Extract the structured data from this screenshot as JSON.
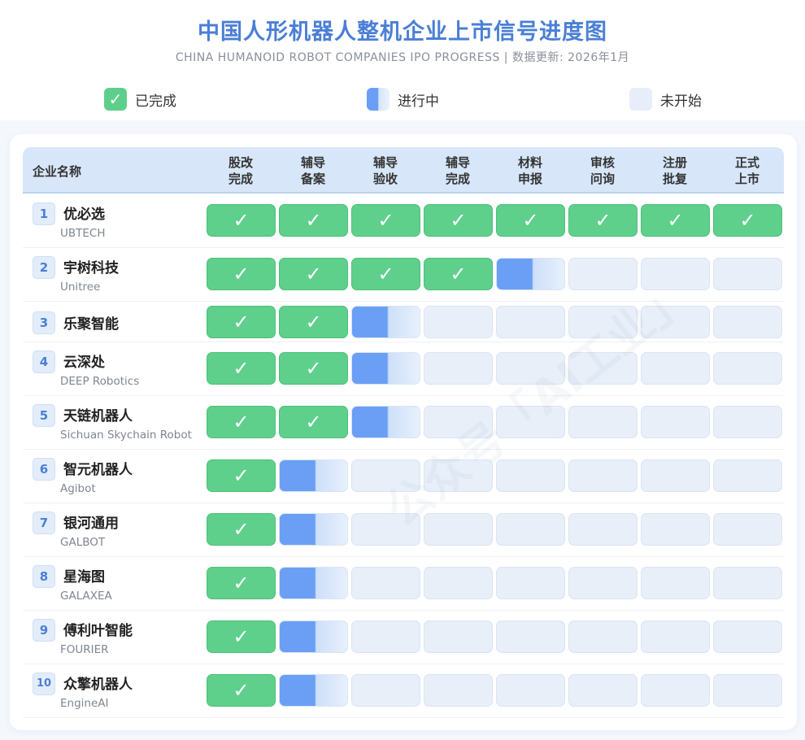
{
  "title": "中国人形机器人整机企业上市信号进度图",
  "subtitle": "CHINA HUMANOID ROBOT COMPANIES IPO PROGRESS | 数据更新: 2026年1月",
  "legend": [
    {
      "label": "已完成",
      "status": "done"
    },
    {
      "label": "进行中",
      "status": "in_progress"
    },
    {
      "label": "未开始",
      "status": "not_started"
    }
  ],
  "colors": {
    "done": "#5ed08c",
    "in_progress": "#6a9ff5",
    "not_started": "#e8eff9",
    "accent": "#4a7fd6"
  },
  "watermark": "公众号「AI工业」",
  "chart_data": {
    "type": "table",
    "title": "中国人形机器人整机企业上市信号进度图",
    "subtitle": "CHINA HUMANOID ROBOT COMPANIES IPO PROGRESS | 数据更新: 2026年1月",
    "header_company": "企业名称",
    "stages": [
      [
        "股改",
        "完成"
      ],
      [
        "辅导",
        "备案"
      ],
      [
        "辅导",
        "验收"
      ],
      [
        "辅导",
        "完成"
      ],
      [
        "材料",
        "申报"
      ],
      [
        "审核",
        "问询"
      ],
      [
        "注册",
        "批复"
      ],
      [
        "正式",
        "上市"
      ]
    ],
    "rows": [
      {
        "index": "1",
        "name": "优必选",
        "en": "UBTECH",
        "completed": 8,
        "in_progress": false
      },
      {
        "index": "2",
        "name": "宇树科技",
        "en": "Unitree",
        "completed": 4,
        "in_progress": true
      },
      {
        "index": "3",
        "name": "乐聚智能",
        "en": "",
        "completed": 2,
        "in_progress": true
      },
      {
        "index": "4",
        "name": "云深处",
        "en": "DEEP Robotics",
        "completed": 2,
        "in_progress": true
      },
      {
        "index": "5",
        "name": "天链机器人",
        "en": "Sichuan Skychain Robot",
        "completed": 2,
        "in_progress": true
      },
      {
        "index": "6",
        "name": "智元机器人",
        "en": "Agibot",
        "completed": 1,
        "in_progress": true
      },
      {
        "index": "7",
        "name": "银河通用",
        "en": "GALBOT",
        "completed": 1,
        "in_progress": true
      },
      {
        "index": "8",
        "name": "星海图",
        "en": "GALAXEA",
        "completed": 1,
        "in_progress": true
      },
      {
        "index": "9",
        "name": "傅利叶智能",
        "en": "FOURIER",
        "completed": 1,
        "in_progress": true
      },
      {
        "index": "10",
        "name": "众擎机器人",
        "en": "EngineAI",
        "completed": 1,
        "in_progress": true
      }
    ]
  }
}
